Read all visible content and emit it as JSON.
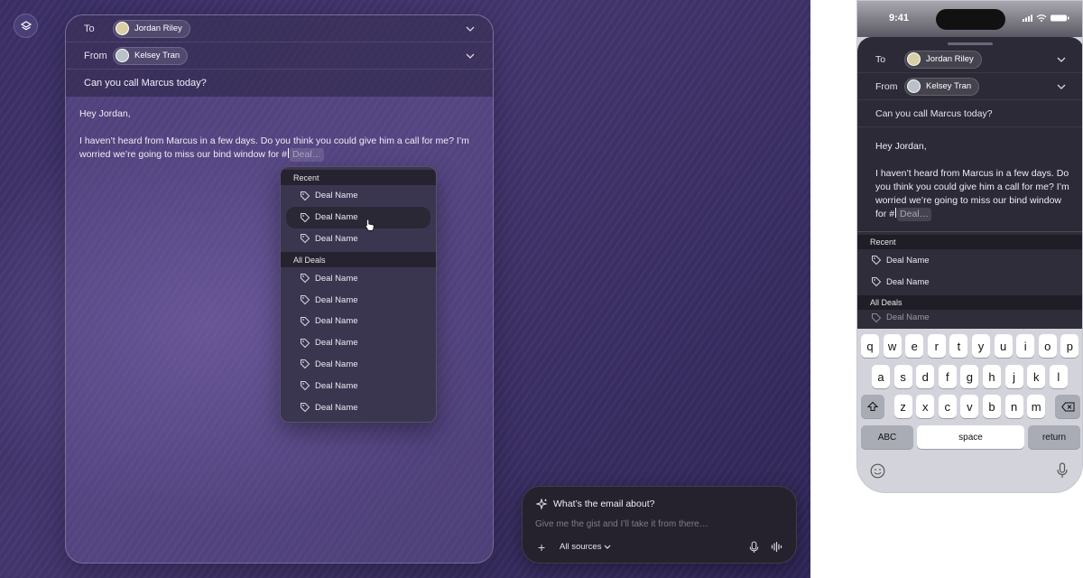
{
  "compose": {
    "to_label": "To",
    "to_name": "Jordan Riley",
    "from_label": "From",
    "from_name": "Kelsey Tran",
    "subject": "Can you call Marcus today?",
    "greeting": "Hey Jordan,",
    "body_line1": "I haven’t heard from Marcus in a few days. Do you think you could give him a call for me? I’m",
    "body_line2": "worried we’re going to miss our bind window for",
    "hash": "#",
    "placeholder": "Deal…"
  },
  "dropdown": {
    "recent_header": "Recent",
    "recent": [
      "Deal Name",
      "Deal Name",
      "Deal Name"
    ],
    "all_header": "All Deals",
    "all": [
      "Deal Name",
      "Deal Name",
      "Deal Name",
      "Deal Name",
      "Deal Name",
      "Deal Name",
      "Deal Name"
    ]
  },
  "prompt": {
    "title": "What’s the email about?",
    "placeholder": "Give me the gist and I’ll take it from there…",
    "sources": "All sources"
  },
  "phone": {
    "time": "9:41",
    "to_label": "To",
    "to_name": "Jordan Riley",
    "from_label": "From",
    "from_name": "Kelsey Tran",
    "subject": "Can you call Marcus today?",
    "greeting": "Hey Jordan,",
    "body": "I haven’t heard from Marcus in a few days. Do you think you could give him a call for me? I’m worried we’re going to miss our bind window for",
    "hash": "#",
    "placeholder": "Deal…",
    "recent_header": "Recent",
    "recent": [
      "Deal Name",
      "Deal Name"
    ],
    "all_header": "All Deals",
    "all": [
      "Deal Name"
    ],
    "keys_row1": [
      "q",
      "w",
      "e",
      "r",
      "t",
      "y",
      "u",
      "i",
      "o",
      "p"
    ],
    "keys_row2": [
      "a",
      "s",
      "d",
      "f",
      "g",
      "h",
      "j",
      "k",
      "l"
    ],
    "keys_row3": [
      "z",
      "x",
      "c",
      "v",
      "b",
      "n",
      "m"
    ],
    "key_abc": "ABC",
    "key_space": "space",
    "key_return": "return"
  }
}
